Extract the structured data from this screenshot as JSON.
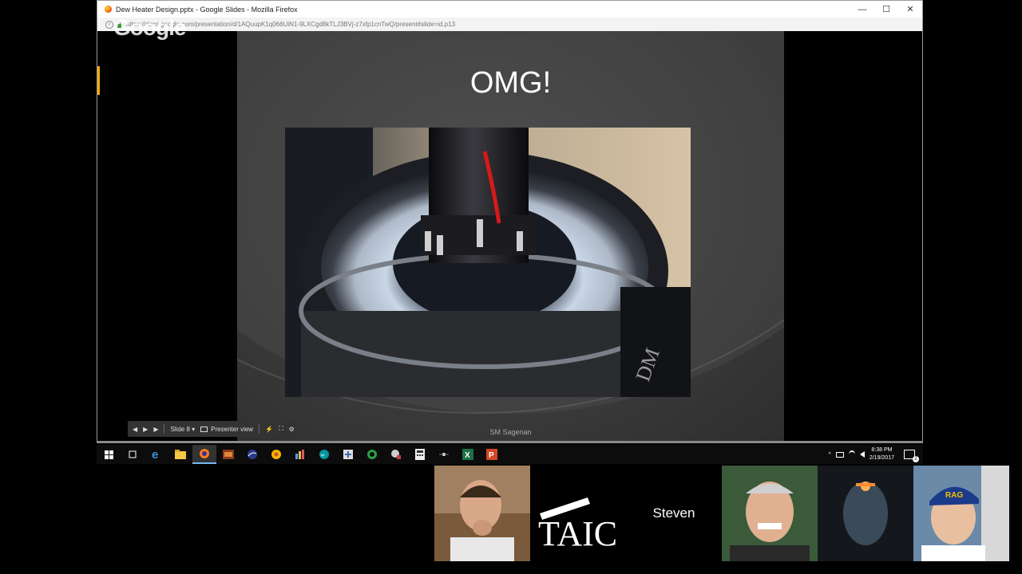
{
  "window": {
    "title": "Dew Heater Design.pptx - Google Slides - Mozilla Firefox",
    "url": "https://docs.google.com/presentation/d/1AQuupK1q066UiN1-9LXCgd8kTLJ3BVj-z7xfp1cnTwQ/present#slide=id.p13",
    "minimize": "—",
    "maximize": "☐",
    "close": "✕"
  },
  "watermark": "Google",
  "slide": {
    "title": "OMG!",
    "footer": "SM Sagenan"
  },
  "toolbar": {
    "prev": "◀",
    "play": "▶",
    "next": "▶",
    "slide_label": "Slide 8 ▾",
    "presenter_view": "Presenter view",
    "laser": "⚡",
    "fullscreen": "⛶",
    "settings": "⚙"
  },
  "taskbar": {
    "time": "8:38 PM",
    "date": "2/19/2017",
    "notifications": "2",
    "icons": [
      "windows-start-icon",
      "task-view-icon",
      "edge-icon",
      "file-explorer-icon",
      "firefox-icon",
      "app-icon",
      "stellarium-icon",
      "chrome-like-icon",
      "app-icon",
      "arduino-icon",
      "network-icon",
      "app-icon",
      "app-icon",
      "calculator-icon",
      "app-icon",
      "excel-icon",
      "powerpoint-icon"
    ]
  },
  "participants": {
    "named": "Steven",
    "logo_text": "TAIC"
  }
}
